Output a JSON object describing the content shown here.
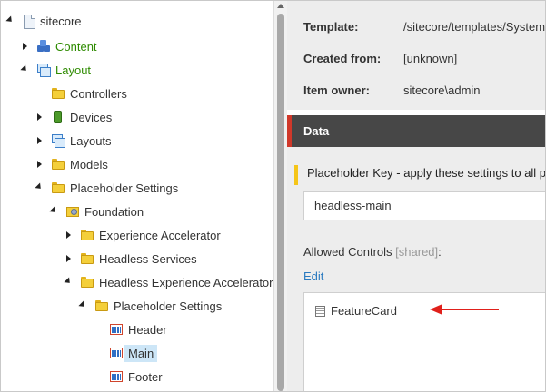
{
  "tree": {
    "nodes": [
      {
        "label": "sitecore",
        "icon": "document-icon",
        "expander": "down"
      },
      {
        "label": "Content",
        "icon": "content-icon",
        "expander": "right"
      },
      {
        "label": "Layout",
        "icon": "layout-icon",
        "expander": "down"
      },
      {
        "label": "Controllers",
        "icon": "folder-icon",
        "expander": "none"
      },
      {
        "label": "Devices",
        "icon": "device-icon",
        "expander": "right"
      },
      {
        "label": "Layouts",
        "icon": "layout-icon",
        "expander": "right"
      },
      {
        "label": "Models",
        "icon": "folder-icon",
        "expander": "right"
      },
      {
        "label": "Placeholder Settings",
        "icon": "folder-icon",
        "expander": "down"
      },
      {
        "label": "Foundation",
        "icon": "foundation-folder-icon",
        "expander": "down"
      },
      {
        "label": "Experience Accelerator",
        "icon": "folder-icon",
        "expander": "right"
      },
      {
        "label": "Headless Services",
        "icon": "folder-icon",
        "expander": "right"
      },
      {
        "label": "Headless Experience Accelerator",
        "icon": "folder-icon",
        "expander": "down"
      },
      {
        "label": "Placeholder Settings",
        "icon": "folder-icon",
        "expander": "down"
      },
      {
        "label": "Header",
        "icon": "placeholder-icon",
        "expander": "none"
      },
      {
        "label": "Main",
        "icon": "placeholder-icon",
        "expander": "none",
        "selected": true
      },
      {
        "label": "Footer",
        "icon": "placeholder-icon",
        "expander": "none"
      }
    ]
  },
  "info": {
    "template_label": "Template:",
    "template_value": "/sitecore/templates/System/Layout/Placeholder",
    "created_from_label": "Created from:",
    "created_from_value": "[unknown]",
    "owner_label": "Item owner:",
    "owner_value": "sitecore\\admin"
  },
  "data_section": {
    "title": "Data",
    "placeholder_key_label": "Placeholder Key - apply these settings to all placeholders with this key",
    "placeholder_key_value": "headless-main",
    "allowed_controls_label": "Allowed Controls",
    "allowed_controls_shared": "[shared]",
    "allowed_controls_colon": ":",
    "edit_link": "Edit",
    "allowed_controls": [
      "FeatureCard"
    ]
  },
  "colors": {
    "accent_red": "#d0382a",
    "field_highlight_yellow": "#f5c518",
    "link_blue": "#2a7ac0",
    "tree_green": "#2e8b00",
    "selected_bg": "#cde6f7"
  }
}
